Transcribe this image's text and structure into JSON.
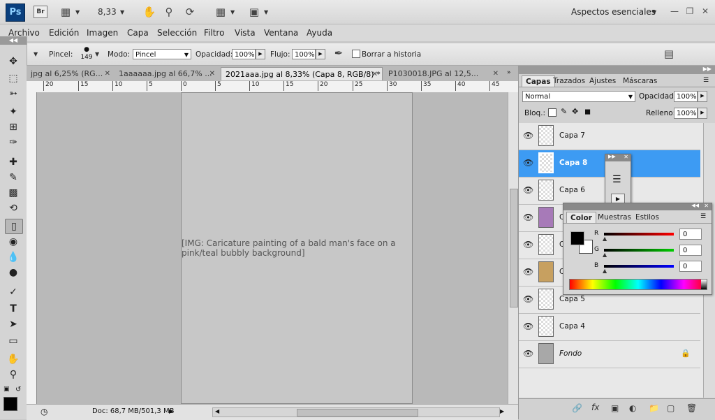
{
  "appbar": {
    "logo": "Ps",
    "bridge": "Br",
    "zoom": "8,33",
    "workspace": "Aspectos esenciales"
  },
  "menu": {
    "items": [
      "Archivo",
      "Edición",
      "Imagen",
      "Capa",
      "Selección",
      "Filtro",
      "Vista",
      "Ventana",
      "Ayuda"
    ]
  },
  "options": {
    "brush_label": "Pincel:",
    "brush_size": "149",
    "mode_label": "Modo:",
    "mode_value": "Pincel",
    "opacity_label": "Opacidad:",
    "opacity_value": "100%",
    "flow_label": "Flujo:",
    "flow_value": "100%",
    "erase_history_label": "Borrar a historia"
  },
  "tabs": [
    {
      "label": "jpg al 6,25% (RG...",
      "active": false
    },
    {
      "label": "1aaaaaa.jpg al 66,7% ...",
      "active": false
    },
    {
      "label": "2021aaa.jpg al 8,33% (Capa 8, RGB/8) *",
      "active": true
    },
    {
      "label": "P1030018.JPG al 12,5...",
      "active": false
    }
  ],
  "ruler": [
    "20",
    "15",
    "10",
    "5",
    "0",
    "5",
    "10",
    "15",
    "20",
    "25",
    "30",
    "35",
    "40",
    "45"
  ],
  "status": {
    "doc": "Doc: 68,7 MB/501,3 MB"
  },
  "layers_panel": {
    "tabs": [
      "Capas",
      "Trazados",
      "Ajustes",
      "Máscaras"
    ],
    "blend_mode": "Normal",
    "opacity_label": "Opacidad:",
    "opacity_value": "100%",
    "lock_label": "Bloq.:",
    "fill_label": "Relleno:",
    "fill_value": "100%",
    "layers": [
      {
        "name": "Capa 7",
        "selected": false
      },
      {
        "name": "Capa 8",
        "selected": true
      },
      {
        "name": "Capa 6",
        "selected": false
      },
      {
        "name": "C",
        "selected": false
      },
      {
        "name": "C",
        "selected": false
      },
      {
        "name": "C",
        "selected": false
      },
      {
        "name": "Capa 5",
        "selected": false
      },
      {
        "name": "Capa 4",
        "selected": false
      },
      {
        "name": "Fondo",
        "selected": false
      }
    ]
  },
  "color_panel": {
    "tabs": [
      "Color",
      "Muestras",
      "Estilos"
    ],
    "r_label": "R",
    "r_value": "0",
    "g_label": "G",
    "g_value": "0",
    "b_label": "B",
    "b_value": "0"
  },
  "colors": {
    "selected_layer": "#3d9bf3",
    "foreground": "#000000",
    "background": "#ffffff"
  }
}
